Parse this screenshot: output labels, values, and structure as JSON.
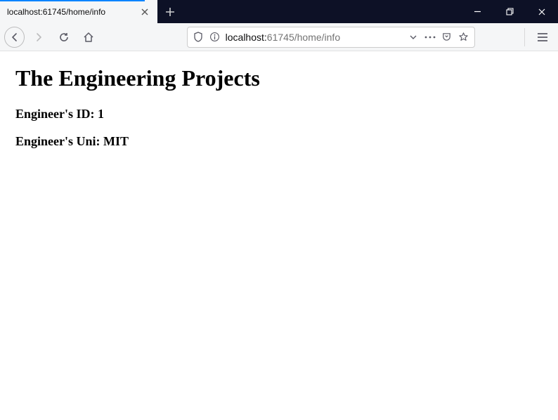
{
  "tab": {
    "title": "localhost:61745/home/info"
  },
  "url": {
    "prefix": "localhost:",
    "rest": "61745/home/info"
  },
  "page": {
    "heading": "The Engineering Projects",
    "id_line": "Engineer's ID: 1",
    "uni_line": "Engineer's Uni: MIT"
  }
}
